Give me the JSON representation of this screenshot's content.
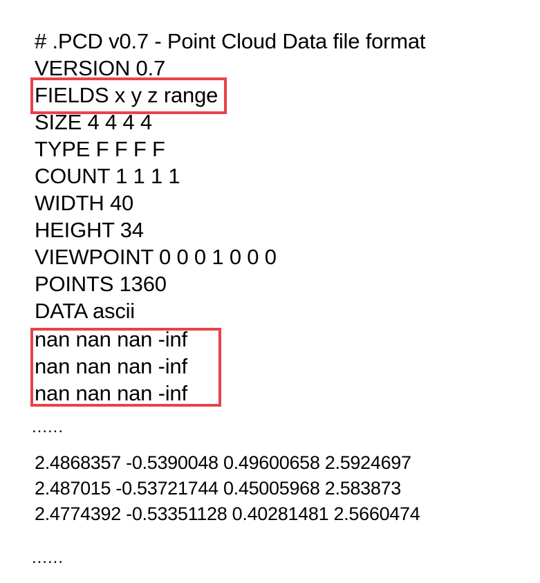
{
  "header": {
    "comment": "# .PCD v0.7 - Point Cloud Data file format"
  },
  "header_fields": [
    "VERSION 0.7",
    "FIELDS x y z range",
    "SIZE 4 4 4 4",
    "TYPE F F F F",
    "COUNT 1 1 1 1",
    "WIDTH 40",
    "HEIGHT 34",
    "VIEWPOINT 0 0 0 1 0 0 0",
    "POINTS 1360",
    "DATA ascii"
  ],
  "nan_rows": [
    "nan nan nan -inf",
    "nan nan nan -inf",
    "nan nan nan -inf"
  ],
  "ellipsis_1": "......",
  "data_rows": [
    "2.4868357 -0.5390048 0.49600658 2.5924697",
    "2.487015 -0.53721744 0.45005968 2.583873",
    "2.4774392 -0.53351128 0.40281481 2.5660474"
  ],
  "ellipsis_2": "......",
  "annotation_color": "#e8424a"
}
